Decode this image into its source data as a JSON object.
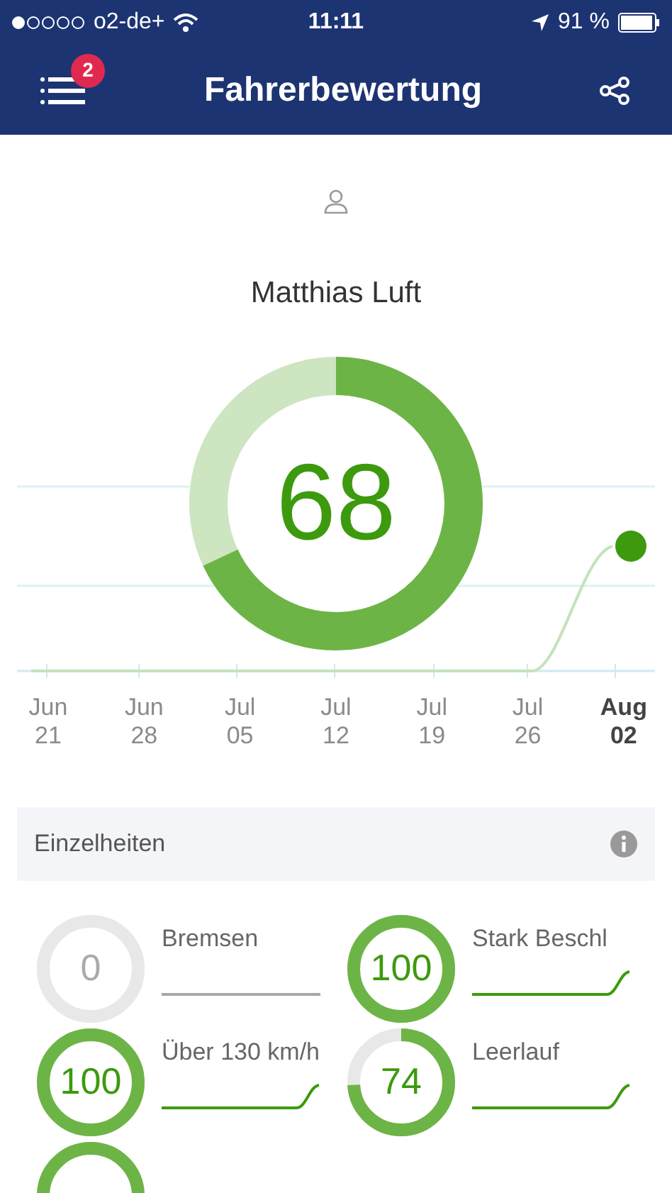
{
  "status_bar": {
    "carrier": "o2-de+",
    "time": "11:11",
    "battery": "91 %"
  },
  "nav": {
    "title": "Fahrerbewertung",
    "badge": "2"
  },
  "driver": {
    "name": "Matthias Luft"
  },
  "score": {
    "value": "68",
    "level": 0.68
  },
  "timeline": {
    "labels": [
      {
        "month": "Jun",
        "day": "21",
        "selected": false
      },
      {
        "month": "Jun",
        "day": "28",
        "selected": false
      },
      {
        "month": "Jul",
        "day": "05",
        "selected": false
      },
      {
        "month": "Jul",
        "day": "12",
        "selected": false
      },
      {
        "month": "Jul",
        "day": "19",
        "selected": false
      },
      {
        "month": "Jul",
        "day": "26",
        "selected": false
      },
      {
        "month": "Aug",
        "day": "02",
        "selected": true
      }
    ]
  },
  "details": {
    "title": "Einzelheiten",
    "items": [
      {
        "kind": "score",
        "score": "0",
        "label": "Bremsen",
        "level": 0
      },
      {
        "kind": "score",
        "score": "100",
        "label": "Stark Beschl",
        "level": 1
      },
      {
        "kind": "score",
        "score": "100",
        "label": "Über 130 km/h",
        "level": 1
      },
      {
        "kind": "score",
        "score": "74",
        "label": "Leerlauf",
        "level": 0.74
      },
      {
        "kind": "cut_off"
      }
    ]
  }
}
